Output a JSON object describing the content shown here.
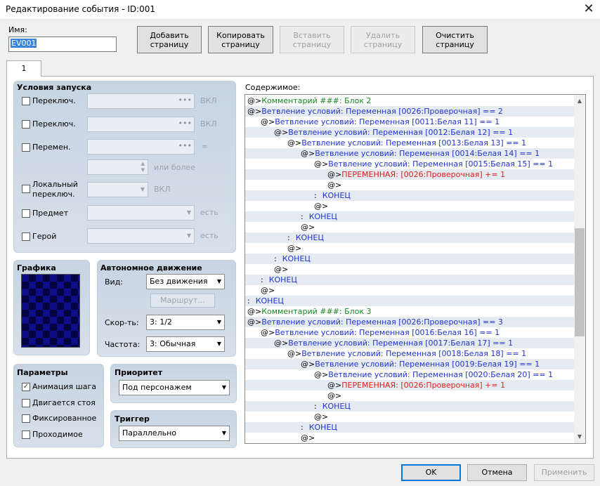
{
  "window": {
    "title": "Редактирование события - ID:001",
    "close": "✕"
  },
  "name": {
    "label": "Имя:",
    "value": "EV001"
  },
  "toolbar": {
    "add": "Добавить страницу",
    "copy": "Копировать страницу",
    "paste": "Вставить страницу",
    "delete": "Удалить страницу",
    "clear": "Очистить страницу"
  },
  "tabs": [
    "1"
  ],
  "conditions": {
    "title": "Условия запуска",
    "switch1": {
      "label": "Переключ.",
      "suffix": "ВКЛ"
    },
    "switch2": {
      "label": "Переключ.",
      "suffix": "ВКЛ"
    },
    "variable": {
      "label": "Перемен.",
      "suffix": "=",
      "more": "или более"
    },
    "self_switch": {
      "label1": "Локальный",
      "label2": "переключ.",
      "suffix": "ВКЛ"
    },
    "item": {
      "label": "Предмет",
      "suffix": "есть"
    },
    "actor": {
      "label": "Герой",
      "suffix": "есть"
    }
  },
  "graphics": {
    "title": "Графика"
  },
  "autonomous": {
    "title": "Автономное движение",
    "type_label": "Вид:",
    "type_value": "Без движения",
    "route_button": "Маршрут...",
    "speed_label": "Скор-ть:",
    "speed_value": "3: 1/2",
    "freq_label": "Частота:",
    "freq_value": "3: Обычная"
  },
  "options": {
    "title": "Параметры",
    "walking": {
      "label": "Анимация шага",
      "checked": true
    },
    "stepping": {
      "label": "Двигается стоя",
      "checked": false
    },
    "direction_fix": {
      "label": "Фиксированное",
      "checked": false
    },
    "through": {
      "label": "Проходимое",
      "checked": false
    }
  },
  "priority": {
    "title": "Приоритет",
    "value": "Под персонажем"
  },
  "trigger": {
    "title": "Триггер",
    "value": "Параллельно"
  },
  "contents": {
    "label": "Содержимое:",
    "rows": [
      {
        "indent": 0,
        "mark": "@>",
        "text": "Комментарий ###: Блок 2",
        "color": "green"
      },
      {
        "indent": 0,
        "mark": "@>",
        "text": "Ветвление условий: Переменная [0026:Проверочная] == 2",
        "color": "blue"
      },
      {
        "indent": 1,
        "mark": "@>",
        "text": "Ветвление условий: Переменная [0011:Белая 11] == 1",
        "color": "blue"
      },
      {
        "indent": 2,
        "mark": "@>",
        "text": "Ветвление условий: Переменная [0012:Белая 12] == 1",
        "color": "blue"
      },
      {
        "indent": 3,
        "mark": "@>",
        "text": "Ветвление условий: Переменная [0013:Белая 13] == 1",
        "color": "blue"
      },
      {
        "indent": 4,
        "mark": "@>",
        "text": "Ветвление условий: Переменная [0014:Белая 14] == 1",
        "color": "blue"
      },
      {
        "indent": 5,
        "mark": "@>",
        "text": "Ветвление условий: Переменная [0015:Белая 15] == 1",
        "color": "blue"
      },
      {
        "indent": 6,
        "mark": "@>",
        "text": "ПЕРЕМЕННАЯ: [0026:Проверочная] += 1",
        "color": "red"
      },
      {
        "indent": 6,
        "mark": "@>",
        "text": "",
        "color": "black"
      },
      {
        "indent": 5,
        "mark": " :",
        "text": "КОНЕЦ",
        "color": "blue"
      },
      {
        "indent": 5,
        "mark": "@>",
        "text": "",
        "color": "black"
      },
      {
        "indent": 4,
        "mark": " :",
        "text": "КОНЕЦ",
        "color": "blue"
      },
      {
        "indent": 4,
        "mark": "@>",
        "text": "",
        "color": "black"
      },
      {
        "indent": 3,
        "mark": " :",
        "text": "КОНЕЦ",
        "color": "blue"
      },
      {
        "indent": 3,
        "mark": "@>",
        "text": "",
        "color": "black"
      },
      {
        "indent": 2,
        "mark": " :",
        "text": "КОНЕЦ",
        "color": "blue"
      },
      {
        "indent": 2,
        "mark": "@>",
        "text": "",
        "color": "black"
      },
      {
        "indent": 1,
        "mark": " :",
        "text": "КОНЕЦ",
        "color": "blue"
      },
      {
        "indent": 1,
        "mark": "@>",
        "text": "",
        "color": "black"
      },
      {
        "indent": 0,
        "mark": " :",
        "text": "КОНЕЦ",
        "color": "blue"
      },
      {
        "indent": 0,
        "mark": "@>",
        "text": "Комментарий ###: Блок 3",
        "color": "green"
      },
      {
        "indent": 0,
        "mark": "@>",
        "text": "Ветвление условий: Переменная [0026:Проверочная] == 3",
        "color": "blue"
      },
      {
        "indent": 1,
        "mark": "@>",
        "text": "Ветвление условий: Переменная [0016:Белая 16] == 1",
        "color": "blue"
      },
      {
        "indent": 2,
        "mark": "@>",
        "text": "Ветвление условий: Переменная [0017:Белая 17] == 1",
        "color": "blue"
      },
      {
        "indent": 3,
        "mark": "@>",
        "text": "Ветвление условий: Переменная [0018:Белая 18] == 1",
        "color": "blue"
      },
      {
        "indent": 4,
        "mark": "@>",
        "text": "Ветвление условий: Переменная [0019:Белая 19] == 1",
        "color": "blue"
      },
      {
        "indent": 5,
        "mark": "@>",
        "text": "Ветвление условий: Переменная [0020:Белая 20] == 1",
        "color": "blue"
      },
      {
        "indent": 6,
        "mark": "@>",
        "text": "ПЕРЕМЕННАЯ: [0026:Проверочная] += 1",
        "color": "red"
      },
      {
        "indent": 6,
        "mark": "@>",
        "text": "",
        "color": "black"
      },
      {
        "indent": 5,
        "mark": " :",
        "text": "КОНЕЦ",
        "color": "blue"
      },
      {
        "indent": 5,
        "mark": "@>",
        "text": "",
        "color": "black"
      },
      {
        "indent": 4,
        "mark": " :",
        "text": "КОНЕЦ",
        "color": "blue"
      },
      {
        "indent": 4,
        "mark": "@>",
        "text": "",
        "color": "black"
      }
    ]
  },
  "footer": {
    "ok": "OK",
    "cancel": "Отмена",
    "apply": "Применить"
  }
}
